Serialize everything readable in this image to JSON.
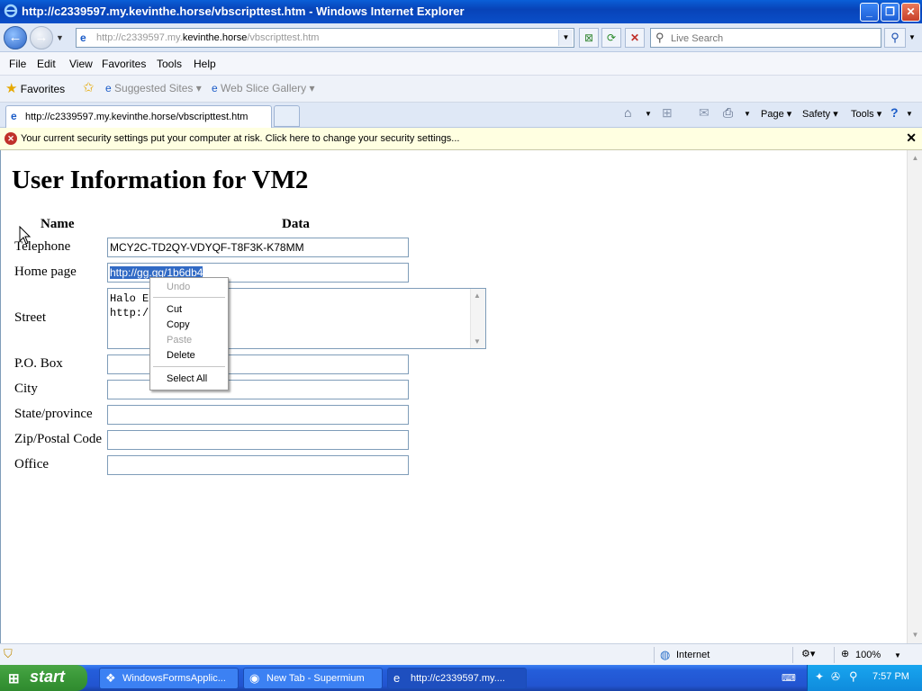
{
  "window": {
    "title": "http://c2339597.my.kevinthe.horse/vbscripttest.htm - Windows Internet Explorer",
    "minimize": "_",
    "restore": "❐",
    "close": "✕"
  },
  "address": {
    "url_prefix": "http://c2339597.my.",
    "url_domain": "kevinthe.horse",
    "url_suffix": "/vbscripttest.htm",
    "search_placeholder": "Live Search"
  },
  "menu": [
    "File",
    "Edit",
    "View",
    "Favorites",
    "Tools",
    "Help"
  ],
  "favorites_bar": {
    "favorites": "Favorites",
    "suggested": "Suggested Sites ▾",
    "webslice": "Web Slice Gallery ▾"
  },
  "tab": {
    "label": "http://c2339597.my.kevinthe.horse/vbscripttest.htm"
  },
  "commandbar": {
    "page": "Page ▾",
    "safety": "Safety ▾",
    "tools": "Tools ▾"
  },
  "infobar": {
    "message": "Your current security settings put your computer at risk. Click here to change your security settings...",
    "close": "✕"
  },
  "page": {
    "heading": "User Information for VM2",
    "col_name": "Name",
    "col_data": "Data",
    "fields": {
      "telephone_label": "Telephone",
      "telephone_value": "MCY2C-TD2QY-VDYQF-T8F3K-K78MM",
      "homepage_label": "Home page",
      "homepage_value": "http://gg.gg/1b6db4",
      "street_label": "Street",
      "street_line1": "Halo E        0.10",
      "street_line2": "http:/         ca2",
      "pobox_label": "P.O. Box",
      "city_label": "City",
      "state_label": "State/province",
      "zip_label": "Zip/Postal Code",
      "office_label": "Office"
    }
  },
  "context_menu": {
    "undo": "Undo",
    "cut": "Cut",
    "copy": "Copy",
    "paste": "Paste",
    "delete": "Delete",
    "select_all": "Select All"
  },
  "statusbar": {
    "zone": "Internet",
    "zoom": "100%"
  },
  "taskbar": {
    "start": "start",
    "tasks": [
      "WindowsFormsApplic...",
      "New Tab - Supermium",
      "http://c2339597.my...."
    ],
    "clock": "7:57 PM"
  },
  "colors": {
    "titlebar": "#0a4fc9",
    "selection": "#316ac5",
    "infobar": "#ffffe1",
    "taskbar": "#245edb",
    "start": "#3c9a3a"
  }
}
